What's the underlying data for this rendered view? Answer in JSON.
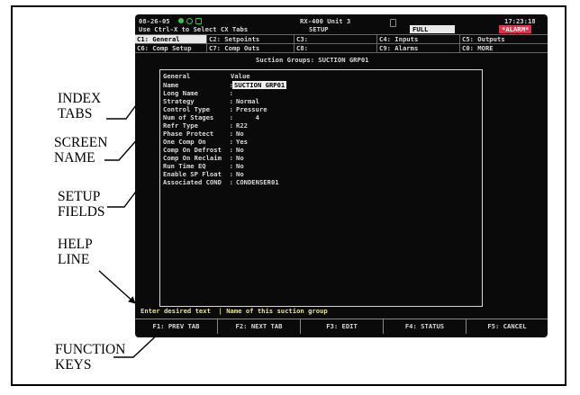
{
  "header": {
    "date": "08-26-05",
    "unit": "RX-400 Unit 3",
    "time": "17:23:18",
    "hint": "Use Ctrl-X to Select CX Tabs",
    "mode": "SETUP",
    "full_badge": "FULL",
    "alarm_badge": "*ALARM*"
  },
  "tabs_row1": [
    "C1: General",
    "C2: Setpoints",
    "C3:",
    "C4: Inputs",
    "C5: Outputs"
  ],
  "tabs_row2": [
    "C6: Comp Setup",
    "C7: Comp Outs",
    "C8:",
    "C9: Alarms",
    "C0: MORE"
  ],
  "screen_name": "Suction Groups: SUCTION GRP01",
  "fields_header": {
    "col1": "General",
    "col2": "Value"
  },
  "fields": [
    {
      "label": "Name             :",
      "value": "SUCTION GRP01"
    },
    {
      "label": "Long Name        :",
      "value": ""
    },
    {
      "label": "Strategy         :",
      "value": "Normal"
    },
    {
      "label": "Control Type     :",
      "value": "Pressure"
    },
    {
      "label": "Num of Stages    :",
      "value": "     4"
    },
    {
      "label": "Refr Type        :",
      "value": "R22"
    },
    {
      "label": "Phase Protect    :",
      "value": "No"
    },
    {
      "label": "One Comp On      :",
      "value": "Yes"
    },
    {
      "label": "Comp On Defrost  :",
      "value": "No"
    },
    {
      "label": "Comp On Reclaim  :",
      "value": "No"
    },
    {
      "label": "Run Time EQ      :",
      "value": "No"
    },
    {
      "label": "Enable SP Float  :",
      "value": "No"
    },
    {
      "label": "Associated COND  :",
      "value": "CONDENSER01"
    }
  ],
  "help_line": "Enter desired text  | Name of this suction group",
  "function_keys": [
    "F1: PREV TAB",
    "F2: NEXT TAB",
    "F3: EDIT",
    "F4: STATUS",
    "F5: CANCEL"
  ],
  "callouts": {
    "index_tabs": [
      "INDEX",
      "TABS"
    ],
    "screen_name": [
      "SCREEN",
      "NAME"
    ],
    "setup_fields": [
      "SETUP",
      "FIELDS"
    ],
    "help_line": [
      "HELP",
      "LINE"
    ],
    "function_keys": [
      "FUNCTION",
      "KEYS"
    ]
  },
  "colors": {
    "screen_bg": "#0a0a0a",
    "text": "#d8d8d8",
    "help": "#e8e29a",
    "alarm": "#e0304a",
    "led": "#39c24a"
  }
}
